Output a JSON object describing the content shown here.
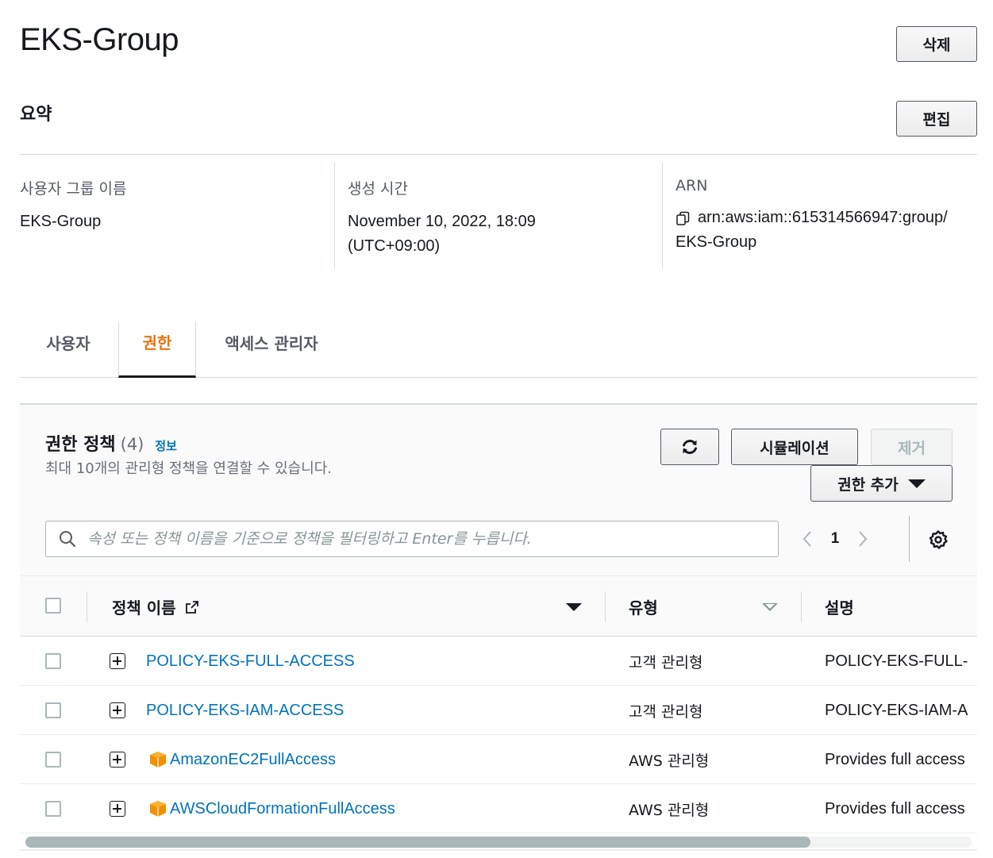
{
  "page": {
    "title": "EKS-Group",
    "delete_label": "삭제"
  },
  "summary": {
    "title": "요약",
    "edit_label": "편집",
    "group_name_label": "사용자 그룹 이름",
    "group_name_value": "EKS-Group",
    "created_label": "생성 시간",
    "created_value_line1": "November 10, 2022, 18:09",
    "created_value_line2": "(UTC+09:00)",
    "arn_label": "ARN",
    "arn_value_line1": "arn:aws:iam::615314566947:group/",
    "arn_value_line2": "EKS-Group"
  },
  "tabs": [
    {
      "label": "사용자",
      "active": false
    },
    {
      "label": "권한",
      "active": true
    },
    {
      "label": "액세스 관리자",
      "active": false
    }
  ],
  "permissions": {
    "title": "권한 정책",
    "count": "(4)",
    "info_label": "정보",
    "description": "최대 10개의 관리형 정책을 연결할 수 있습니다.",
    "simulate_label": "시뮬레이션",
    "remove_label": "제거",
    "add_label": "권한 추가",
    "search_placeholder": "속성 또는 정책 이름을 기준으로 정책을 필터링하고 Enter를 누릅니다.",
    "page_number": "1",
    "columns": {
      "name": "정책 이름",
      "type": "유형",
      "description": "설명"
    },
    "rows": [
      {
        "name": "POLICY-EKS-FULL-ACCESS",
        "type": "고객 관리형",
        "description": "POLICY-EKS-FULL-",
        "aws_icon": false
      },
      {
        "name": "POLICY-EKS-IAM-ACCESS",
        "type": "고객 관리형",
        "description": "POLICY-EKS-IAM-A",
        "aws_icon": false
      },
      {
        "name": "AmazonEC2FullAccess",
        "type": "AWS 관리형",
        "description": "Provides full access",
        "aws_icon": true
      },
      {
        "name": "AWSCloudFormationFullAccess",
        "type": "AWS 관리형",
        "description": "Provides full access",
        "aws_icon": true
      }
    ],
    "horizontal_scroll_fraction": 0.83
  },
  "colors": {
    "accent": "#ec7211",
    "link": "#0073bb",
    "aws_icon": "#f29100"
  }
}
